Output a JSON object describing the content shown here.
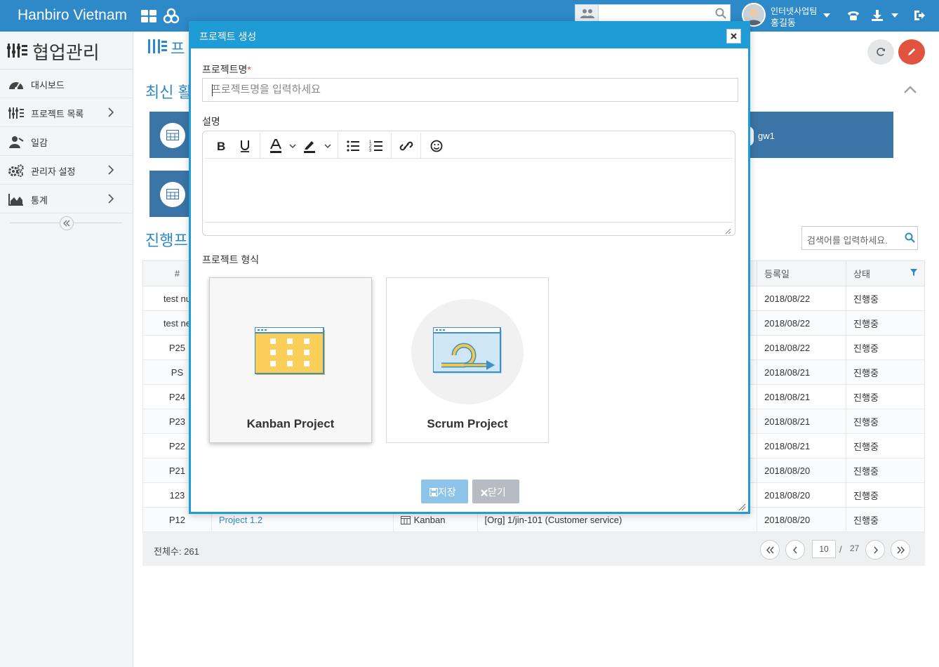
{
  "topbar": {
    "brand": "Hanbiro Vietnam",
    "user_team": "인터넷사업팀",
    "user_name": "홍길동",
    "colors": {
      "bar": "#2e89c8"
    }
  },
  "sidebar": {
    "title": "협업관리",
    "items": [
      {
        "label": "대시보드",
        "icon": "dashboard-icon",
        "has_arrow": false
      },
      {
        "label": "프로젝트 목록",
        "icon": "project-list-icon",
        "has_arrow": true
      },
      {
        "label": "일감",
        "icon": "worker-icon",
        "has_arrow": false
      },
      {
        "label": "관리자 설정",
        "icon": "gears-icon",
        "has_arrow": true
      },
      {
        "label": "통계",
        "icon": "area-chart-icon",
        "has_arrow": true
      }
    ]
  },
  "main": {
    "page_title": "프",
    "recent_title": "최신 활",
    "progress_title": "진행프",
    "card_user": "gw1",
    "search_placeholder": "검색어를 입력하세요.",
    "table": {
      "headers": [
        "#",
        "등록일",
        "상태"
      ],
      "rows": [
        {
          "id": "test nu",
          "date": "2018/08/22",
          "status": "진행중"
        },
        {
          "id": "test ne",
          "date": "2018/08/22",
          "status": "진행중"
        },
        {
          "id": "P25",
          "date": "2018/08/22",
          "status": "진행중"
        },
        {
          "id": "PS",
          "date": "2018/08/21",
          "status": "진행중"
        },
        {
          "id": "P24",
          "date": "2018/08/21",
          "status": "진행중"
        },
        {
          "id": "P23",
          "date": "2018/08/21",
          "status": "진행중"
        },
        {
          "id": "P22",
          "date": "2018/08/21",
          "status": "진행중"
        },
        {
          "id": "P21",
          "date": "2018/08/20",
          "status": "진행중"
        },
        {
          "id": "123",
          "date": "2018/08/20",
          "status": "진행중"
        }
      ],
      "last_row": {
        "id": "P12",
        "name": "Project 1.2",
        "type": "Kanban",
        "org": "[Org] 1/jin-101 (Customer service)",
        "date": "2018/08/20",
        "status": "진행중"
      }
    },
    "footer": {
      "total": "전체수: 261",
      "page_size": "10",
      "sep": "/",
      "pages": "27"
    }
  },
  "modal": {
    "title": "프로젝트 생성",
    "name_label": "프로젝트명",
    "required_mark": "*",
    "name_placeholder": "프로젝트명을 입력하세요",
    "desc_label": "설명",
    "type_label": "프로젝트 형식",
    "types": [
      {
        "label": "Kanban Project",
        "selected": true
      },
      {
        "label": "Scrum Project",
        "selected": false
      }
    ],
    "save_label": "저장",
    "close_label": "닫기",
    "colors": {
      "header": "#1f9bd6",
      "save": "#8dc4ea",
      "close": "#b6bcc1",
      "kanban_board": "#f9cf5a"
    }
  }
}
